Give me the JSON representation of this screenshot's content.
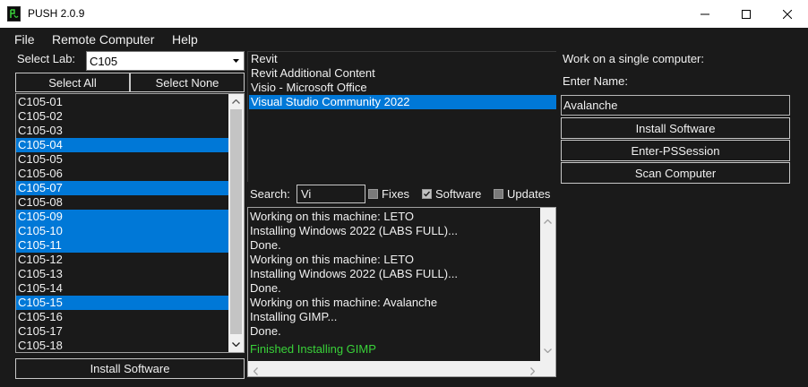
{
  "window": {
    "title": "PUSH 2.0.9",
    "colors": {
      "accent": "#0078d7",
      "background": "#1a1a1a",
      "success_text": "#39d239"
    }
  },
  "menu": {
    "items": [
      "File",
      "Remote Computer",
      "Help"
    ]
  },
  "lab": {
    "label": "Select Lab:",
    "selected": "C105",
    "select_all": "Select All",
    "select_none": "Select None",
    "computers": [
      {
        "name": "C105-01",
        "selected": false
      },
      {
        "name": "C105-02",
        "selected": false
      },
      {
        "name": "C105-03",
        "selected": false
      },
      {
        "name": "C105-04",
        "selected": true
      },
      {
        "name": "C105-05",
        "selected": false
      },
      {
        "name": "C105-06",
        "selected": false
      },
      {
        "name": "C105-07",
        "selected": true
      },
      {
        "name": "C105-08",
        "selected": false
      },
      {
        "name": "C105-09",
        "selected": true
      },
      {
        "name": "C105-10",
        "selected": true
      },
      {
        "name": "C105-11",
        "selected": true
      },
      {
        "name": "C105-12",
        "selected": false
      },
      {
        "name": "C105-13",
        "selected": false
      },
      {
        "name": "C105-14",
        "selected": false
      },
      {
        "name": "C105-15",
        "selected": true
      },
      {
        "name": "C105-16",
        "selected": false
      },
      {
        "name": "C105-17",
        "selected": false
      },
      {
        "name": "C105-18",
        "selected": false
      }
    ],
    "install_button": "Install Software"
  },
  "software": {
    "items": [
      {
        "name": "Revit",
        "selected": false
      },
      {
        "name": "Revit Additional Content",
        "selected": false
      },
      {
        "name": "Visio - Microsoft Office",
        "selected": false
      },
      {
        "name": "Visual Studio Community 2022",
        "selected": true
      }
    ]
  },
  "search": {
    "label": "Search:",
    "value": "Vi",
    "filters": [
      {
        "label": "Fixes",
        "checked": false
      },
      {
        "label": "Software",
        "checked": true
      },
      {
        "label": "Updates",
        "checked": false
      }
    ]
  },
  "output": {
    "lines": [
      {
        "text": "Working on this machine: LETO",
        "green": false
      },
      {
        "text": "Installing Windows 2022 (LABS FULL)...",
        "green": false
      },
      {
        "text": "Done.",
        "green": false
      },
      {
        "text": "Working on this machine: LETO",
        "green": false
      },
      {
        "text": "Installing Windows 2022 (LABS FULL)...",
        "green": false
      },
      {
        "text": "Done.",
        "green": false
      },
      {
        "text": "Working on this machine: Avalanche",
        "green": false
      },
      {
        "text": "Installing GIMP...",
        "green": false
      },
      {
        "text": "Done.",
        "green": false
      },
      {
        "text": "Finished Installing GIMP",
        "green": true
      }
    ]
  },
  "single": {
    "heading": "Work on a single computer:",
    "name_label": "Enter Name:",
    "name_value": "Avalanche",
    "install_button": "Install Software",
    "pssession_button": "Enter-PSSession",
    "scan_button": "Scan Computer"
  }
}
